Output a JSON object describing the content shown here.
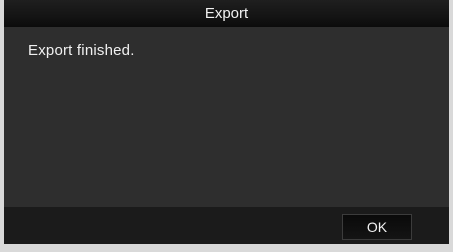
{
  "dialog": {
    "title": "Export",
    "message": "Export finished.",
    "ok_label": "OK"
  }
}
